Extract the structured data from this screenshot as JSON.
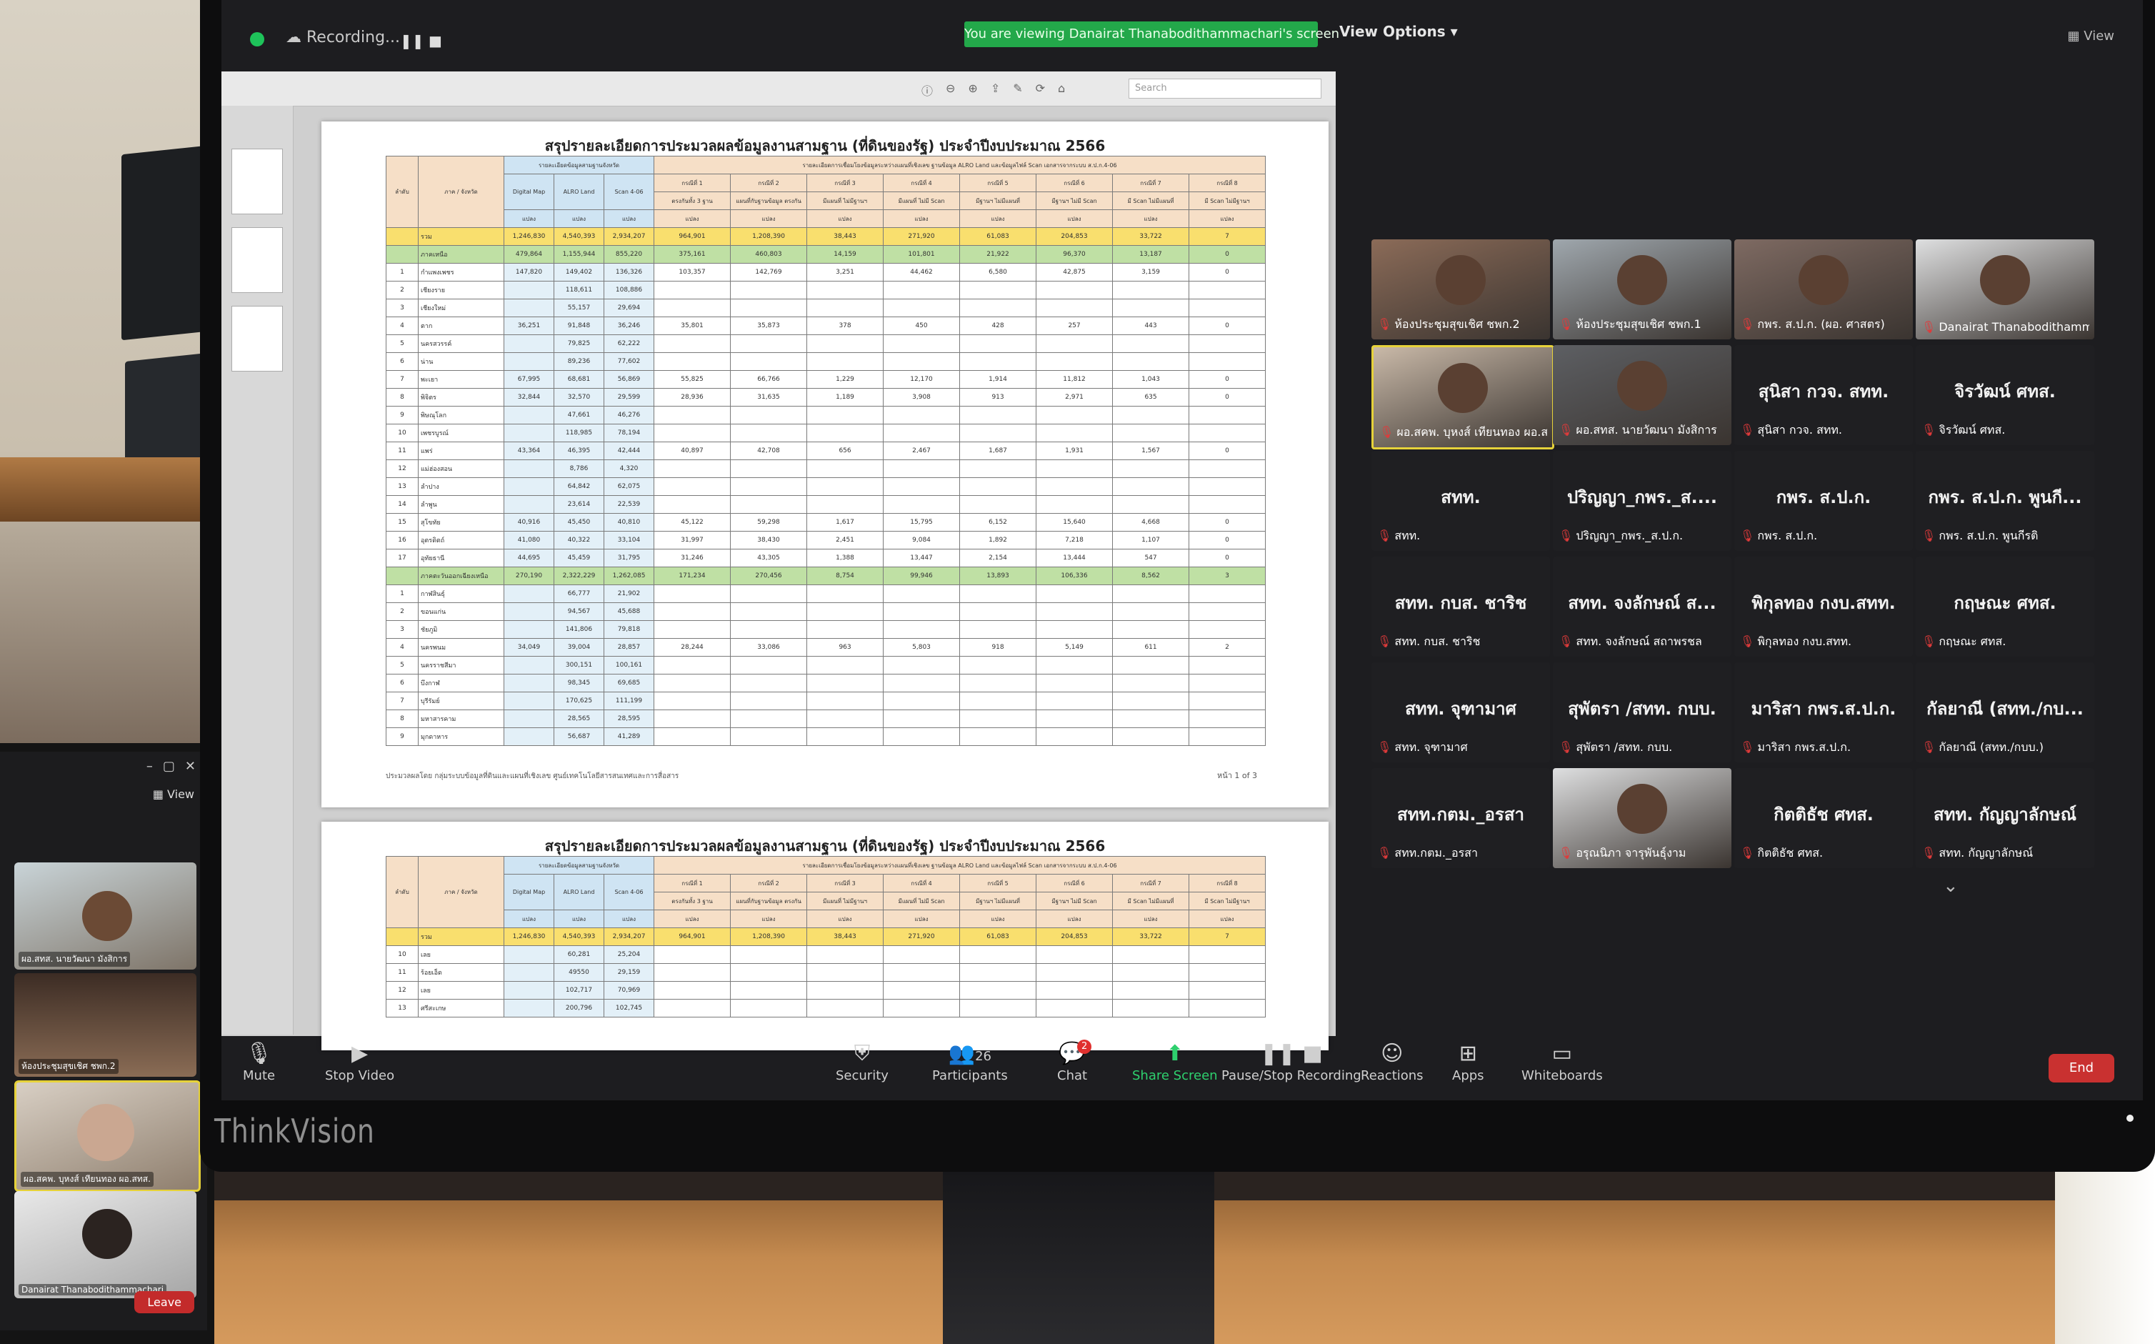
{
  "zoom": {
    "recording_label": "Recording...",
    "viewing_banner": "You are viewing Danairat Thanabodithammachari's screen",
    "view_options": "View Options ▾",
    "view_label": "View",
    "toolbar": {
      "mute": "Mute",
      "stop_video": "Stop Video",
      "security": "Security",
      "participants": "Participants",
      "participants_count": "26",
      "chat": "Chat",
      "chat_badge": "2",
      "share_screen": "Share Screen",
      "pause_recording": "Pause/Stop Recording",
      "reactions": "Reactions",
      "apps": "Apps",
      "whiteboards": "Whiteboards",
      "end": "End"
    },
    "colors": {
      "banner": "#23a84a",
      "end": "#c93130",
      "share": "#2ed06e"
    }
  },
  "document": {
    "search_placeholder": "Search",
    "page1": {
      "title": "สรุปรายละเอียดการประมวลผลข้อมูลงานสามฐาน (ที่ดินของรัฐ) ประจำปีงบประมาณ 2566",
      "header_left": [
        "ลำดับ",
        "ภาค / จังหวัด"
      ],
      "header_group1": "รายละเอียดข้อมูลสามฐานจังหวัด",
      "header_group2": "รายละเอียดการเชื่อมโยงข้อมูลระหว่างแผนที่เชิงเลข ฐานข้อมูล ALRO Land และข้อมูลไฟล์ Scan เอกสารจากระบบ ส.ป.ก.4-06",
      "sub_cols": [
        "Digital Map",
        "ALRO Land",
        "Scan 4-06"
      ],
      "case_cols": [
        "กรณีที่ 1",
        "กรณีที่ 2",
        "กรณีที่ 3",
        "กรณีที่ 4",
        "กรณีที่ 5",
        "กรณีที่ 6",
        "กรณีที่ 7",
        "กรณีที่ 8"
      ],
      "case_desc": [
        "ตรงกันทั้ง 3 ฐาน",
        "แผนที่กับฐานข้อมูล ตรงกัน",
        "มีแผนที่ ไม่มีฐานฯ",
        "มีแผนที่ ไม่มี Scan",
        "มีฐานฯ ไม่มีแผนที่",
        "มีฐานฯ ไม่มี Scan",
        "มี Scan ไม่มีแผนที่",
        "มี Scan ไม่มีฐานฯ"
      ],
      "unit": "แปลง",
      "rows": [
        {
          "no": "",
          "name": "รวม",
          "type": "total",
          "v": [
            "1,246,830",
            "4,540,393",
            "2,934,207",
            "964,901",
            "1,208,390",
            "38,443",
            "271,920",
            "61,083",
            "204,853",
            "33,722",
            "7"
          ]
        },
        {
          "no": "",
          "name": "ภาคเหนือ",
          "type": "region",
          "v": [
            "479,864",
            "1,155,944",
            "855,220",
            "375,161",
            "460,803",
            "14,159",
            "101,801",
            "21,922",
            "96,370",
            "13,187",
            "0"
          ]
        },
        {
          "no": "1",
          "name": "กำแพงเพชร",
          "type": "",
          "v": [
            "147,820",
            "149,402",
            "136,326",
            "103,357",
            "142,769",
            "3,251",
            "44,462",
            "6,580",
            "42,875",
            "3,159",
            "0"
          ]
        },
        {
          "no": "2",
          "name": "เชียงราย",
          "type": "",
          "v": [
            "",
            "118,611",
            "108,886",
            "",
            "",
            "",
            "",
            "",
            "",
            "",
            ""
          ]
        },
        {
          "no": "3",
          "name": "เชียงใหม่",
          "type": "",
          "v": [
            "",
            "55,157",
            "29,694",
            "",
            "",
            "",
            "",
            "",
            "",
            "",
            ""
          ]
        },
        {
          "no": "4",
          "name": "ตาก",
          "type": "",
          "v": [
            "36,251",
            "91,848",
            "36,246",
            "35,801",
            "35,873",
            "378",
            "450",
            "428",
            "257",
            "443",
            "0"
          ]
        },
        {
          "no": "5",
          "name": "นครสวรรค์",
          "type": "",
          "v": [
            "",
            "79,825",
            "62,222",
            "",
            "",
            "",
            "",
            "",
            "",
            "",
            ""
          ]
        },
        {
          "no": "6",
          "name": "น่าน",
          "type": "",
          "v": [
            "",
            "89,236",
            "77,602",
            "",
            "",
            "",
            "",
            "",
            "",
            "",
            ""
          ]
        },
        {
          "no": "7",
          "name": "พะเยา",
          "type": "",
          "v": [
            "67,995",
            "68,681",
            "56,869",
            "55,825",
            "66,766",
            "1,229",
            "12,170",
            "1,914",
            "11,812",
            "1,043",
            "0"
          ]
        },
        {
          "no": "8",
          "name": "พิจิตร",
          "type": "",
          "v": [
            "32,844",
            "32,570",
            "29,599",
            "28,936",
            "31,635",
            "1,189",
            "3,908",
            "913",
            "2,971",
            "635",
            "0"
          ]
        },
        {
          "no": "9",
          "name": "พิษณุโลก",
          "type": "",
          "v": [
            "",
            "47,661",
            "46,276",
            "",
            "",
            "",
            "",
            "",
            "",
            "",
            ""
          ]
        },
        {
          "no": "10",
          "name": "เพชรบูรณ์",
          "type": "",
          "v": [
            "",
            "118,985",
            "78,194",
            "",
            "",
            "",
            "",
            "",
            "",
            "",
            ""
          ]
        },
        {
          "no": "11",
          "name": "แพร่",
          "type": "",
          "v": [
            "43,364",
            "46,395",
            "42,444",
            "40,897",
            "42,708",
            "656",
            "2,467",
            "1,687",
            "1,931",
            "1,567",
            "0"
          ]
        },
        {
          "no": "12",
          "name": "แม่ฮ่องสอน",
          "type": "",
          "v": [
            "",
            "8,786",
            "4,320",
            "",
            "",
            "",
            "",
            "",
            "",
            "",
            ""
          ]
        },
        {
          "no": "13",
          "name": "ลำปาง",
          "type": "",
          "v": [
            "",
            "64,842",
            "62,075",
            "",
            "",
            "",
            "",
            "",
            "",
            "",
            ""
          ]
        },
        {
          "no": "14",
          "name": "ลำพูน",
          "type": "",
          "v": [
            "",
            "23,614",
            "22,539",
            "",
            "",
            "",
            "",
            "",
            "",
            "",
            ""
          ]
        },
        {
          "no": "15",
          "name": "สุโขทัย",
          "type": "",
          "v": [
            "40,916",
            "45,450",
            "40,810",
            "45,122",
            "59,298",
            "1,617",
            "15,795",
            "6,152",
            "15,640",
            "4,668",
            "0"
          ]
        },
        {
          "no": "16",
          "name": "อุตรดิตถ์",
          "type": "",
          "v": [
            "41,080",
            "40,322",
            "33,104",
            "31,997",
            "38,430",
            "2,451",
            "9,084",
            "1,892",
            "7,218",
            "1,107",
            "0"
          ]
        },
        {
          "no": "17",
          "name": "อุทัยธานี",
          "type": "",
          "v": [
            "44,695",
            "45,459",
            "31,795",
            "31,246",
            "43,305",
            "1,388",
            "13,447",
            "2,154",
            "13,444",
            "547",
            "0"
          ]
        },
        {
          "no": "",
          "name": "ภาคตะวันออกเฉียงเหนือ",
          "type": "region",
          "v": [
            "270,190",
            "2,322,229",
            "1,262,085",
            "171,234",
            "270,456",
            "8,754",
            "99,946",
            "13,893",
            "106,336",
            "8,562",
            "3"
          ]
        },
        {
          "no": "1",
          "name": "กาฬสินธุ์",
          "type": "",
          "v": [
            "",
            "66,777",
            "21,902",
            "",
            "",
            "",
            "",
            "",
            "",
            "",
            ""
          ]
        },
        {
          "no": "2",
          "name": "ขอนแก่น",
          "type": "",
          "v": [
            "",
            "94,567",
            "45,688",
            "",
            "",
            "",
            "",
            "",
            "",
            "",
            ""
          ]
        },
        {
          "no": "3",
          "name": "ชัยภูมิ",
          "type": "",
          "v": [
            "",
            "141,806",
            "79,818",
            "",
            "",
            "",
            "",
            "",
            "",
            "",
            ""
          ]
        },
        {
          "no": "4",
          "name": "นครพนม",
          "type": "",
          "v": [
            "34,049",
            "39,004",
            "28,857",
            "28,244",
            "33,086",
            "963",
            "5,803",
            "918",
            "5,149",
            "611",
            "2"
          ]
        },
        {
          "no": "5",
          "name": "นครราชสีมา",
          "type": "",
          "v": [
            "",
            "300,151",
            "100,161",
            "",
            "",
            "",
            "",
            "",
            "",
            "",
            ""
          ]
        },
        {
          "no": "6",
          "name": "บึงกาฬ",
          "type": "",
          "v": [
            "",
            "98,345",
            "69,685",
            "",
            "",
            "",
            "",
            "",
            "",
            "",
            ""
          ]
        },
        {
          "no": "7",
          "name": "บุรีรัมย์",
          "type": "",
          "v": [
            "",
            "170,625",
            "111,199",
            "",
            "",
            "",
            "",
            "",
            "",
            "",
            ""
          ]
        },
        {
          "no": "8",
          "name": "มหาสารคาม",
          "type": "",
          "v": [
            "",
            "28,565",
            "28,595",
            "",
            "",
            "",
            "",
            "",
            "",
            "",
            ""
          ]
        },
        {
          "no": "9",
          "name": "มุกดาหาร",
          "type": "",
          "v": [
            "",
            "56,687",
            "41,289",
            "",
            "",
            "",
            "",
            "",
            "",
            "",
            ""
          ]
        }
      ],
      "footer": "ประมวลผลโดย กลุ่มระบบข้อมูลที่ดินและแผนที่เชิงเลข ศูนย์เทคโนโลยีสารสนเทศและการสื่อสาร",
      "page_num": "หน้า 1 of 3"
    },
    "page2": {
      "title": "สรุปรายละเอียดการประมวลผลข้อมูลงานสามฐาน (ที่ดินของรัฐ) ประจำปีงบประมาณ 2566",
      "rows": [
        {
          "no": "",
          "name": "รวม",
          "type": "total",
          "v": [
            "1,246,830",
            "4,540,393",
            "2,934,207",
            "964,901",
            "1,208,390",
            "38,443",
            "271,920",
            "61,083",
            "204,853",
            "33,722",
            "7"
          ]
        },
        {
          "no": "10",
          "name": "เลย",
          "type": "",
          "v": [
            "",
            "60,281",
            "25,204",
            "",
            "",
            "",
            "",
            "",
            "",
            "",
            ""
          ]
        },
        {
          "no": "11",
          "name": "ร้อยเอ็ด",
          "type": "",
          "v": [
            "",
            "49550",
            "29,159",
            "",
            "",
            "",
            "",
            "",
            "",
            "",
            ""
          ]
        },
        {
          "no": "12",
          "name": "เลย",
          "type": "",
          "v": [
            "",
            "102,717",
            "70,969",
            "",
            "",
            "",
            "",
            "",
            "",
            "",
            ""
          ]
        },
        {
          "no": "13",
          "name": "ศรีสะเกษ",
          "type": "",
          "v": [
            "",
            "200,796",
            "102,745",
            "",
            "",
            "",
            "",
            "",
            "",
            "",
            ""
          ]
        }
      ]
    }
  },
  "participants": [
    {
      "big": "",
      "small": "ห้องประชุมสุขเชิศ ชพก.2",
      "video": true
    },
    {
      "big": "",
      "small": "ห้องประชุมสุขเชิศ ชพก.1",
      "video": true
    },
    {
      "big": "",
      "small": "กพร. ส.ป.ก. (ผอ. ศาสตร)",
      "video": true
    },
    {
      "big": "",
      "small": "Danairat Thanabodithamm...",
      "video": true
    },
    {
      "big": "",
      "small": "ผอ.สคพ. บุหงส์ เทียนทอง ผอ.สทส.",
      "video": true,
      "active": true
    },
    {
      "big": "",
      "small": "ผอ.สทส. นายวัฒนา มังสิการ",
      "video": true
    },
    {
      "big": "สุนิสา กวจ. สทท.",
      "small": "สุนิสา กวจ. สทท."
    },
    {
      "big": "จิรวัฒน์ ศทส.",
      "small": "จิรวัฒน์ ศทส."
    },
    {
      "big": "สทท.",
      "small": "สทท."
    },
    {
      "big": "ปริญญา_กพร._ส....",
      "small": "ปริญญา_กพร._ส.ป.ก."
    },
    {
      "big": "กพร. ส.ป.ก.",
      "small": "กพร. ส.ป.ก."
    },
    {
      "big": "กพร. ส.ป.ก. พูนกี...",
      "small": "กพร. ส.ป.ก. พูนกีรติ"
    },
    {
      "big": "สทท. กบส. ชาริช",
      "small": "สทท. กบส. ชาริช"
    },
    {
      "big": "สทท. จงลักษณ์ ส...",
      "small": "สทท. จงลักษณ์ สถาพรชล"
    },
    {
      "big": "พิกุลทอง กงบ.สทท.",
      "small": "พิกุลทอง กงบ.สทท."
    },
    {
      "big": "กฤษณะ ศทส.",
      "small": "กฤษณะ ศทส."
    },
    {
      "big": "สทท. จุฑามาศ",
      "small": "สทท. จุฑามาศ"
    },
    {
      "big": "สุพัตรา /สทท. กบบ.",
      "small": "สุพัตรา /สทท. กบบ."
    },
    {
      "big": "มาริสา กพร.ส.ป.ก.",
      "small": "มาริสา กพร.ส.ป.ก."
    },
    {
      "big": "กัลยาณี (สทท./กบ...",
      "small": "กัลยาณี (สทท./กบบ.)"
    },
    {
      "big": "สทท.กตม._อรสา",
      "small": "สทท.กตม._อรสา"
    },
    {
      "big": "",
      "small": "อรุณนิภา จารุพันธุ์งาม",
      "video": true
    },
    {
      "big": "กิตติธัช ศทส.",
      "small": "กิตติธัช ศทส."
    },
    {
      "big": "สทท. กัญญาลักษณ์",
      "small": "สทท. กัญญาลักษณ์"
    }
  ],
  "laptop": {
    "view_label": "View",
    "tiles": [
      "ผอ.สทส. นายวัฒนา มังสิการ",
      "ห้องประชุมสุขเชิศ ชพก.2",
      "ผอ.สคพ. บุหงส์ เทียนทอง ผอ.สทส.",
      "Danairat Thanabodithammachari"
    ],
    "leave": "Leave"
  },
  "monitor_brand": "ThinkVision"
}
